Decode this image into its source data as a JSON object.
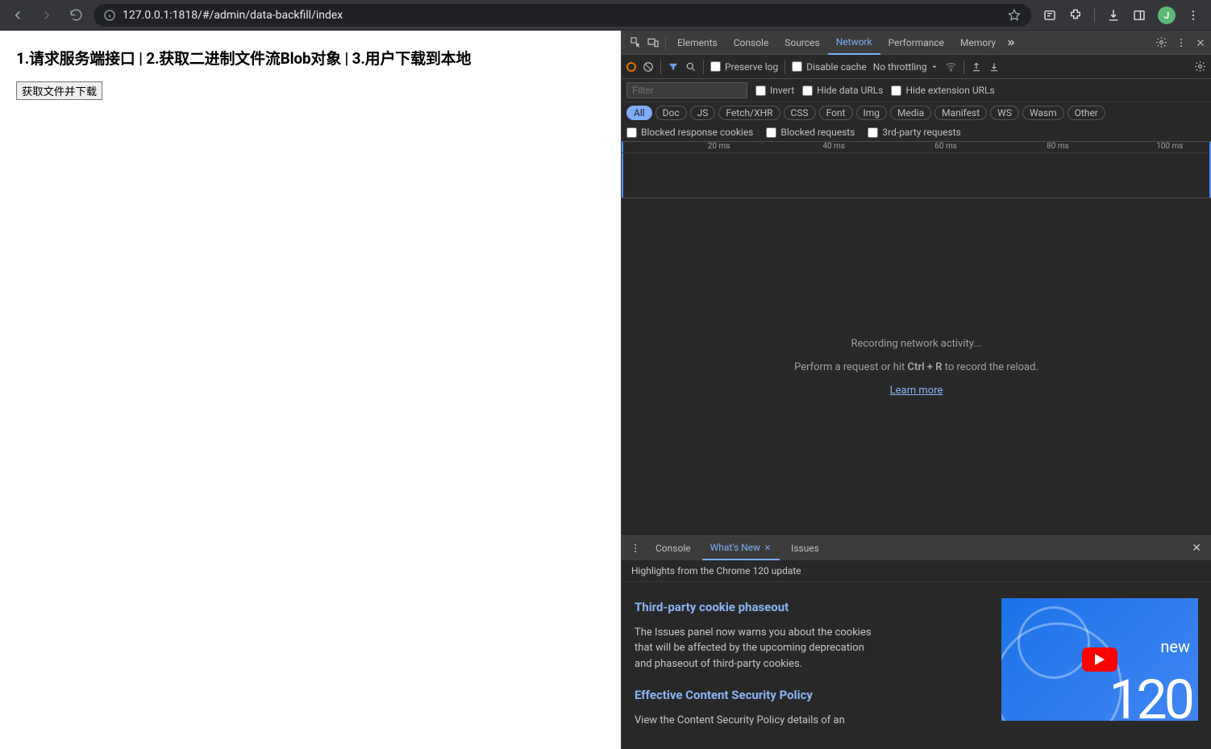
{
  "browser": {
    "url": "127.0.0.1:1818/#/admin/data-backfill/index",
    "avatar_letter": "J"
  },
  "page": {
    "heading": "1.请求服务端接口 | 2.获取二进制文件流Blob对象 | 3.用户下载到本地",
    "download_button": "获取文件并下载"
  },
  "devtools": {
    "tabs": [
      "Elements",
      "Console",
      "Sources",
      "Network",
      "Performance",
      "Memory"
    ],
    "active_tab": "Network",
    "preserve_log": "Preserve log",
    "disable_cache": "Disable cache",
    "throttling": "No throttling",
    "filter_placeholder": "Filter",
    "invert": "Invert",
    "hide_data_urls": "Hide data URLs",
    "hide_ext_urls": "Hide extension URLs",
    "type_chips": [
      "All",
      "Doc",
      "JS",
      "Fetch/XHR",
      "CSS",
      "Font",
      "Img",
      "Media",
      "Manifest",
      "WS",
      "Wasm",
      "Other"
    ],
    "blocked_cookies": "Blocked response cookies",
    "blocked_requests": "Blocked requests",
    "third_party": "3rd-party requests",
    "timeline_ticks": [
      "20 ms",
      "40 ms",
      "60 ms",
      "80 ms",
      "100 ms"
    ],
    "recording_msg": "Recording network activity...",
    "hint_prefix": "Perform a request or hit ",
    "hint_key": "Ctrl + R",
    "hint_suffix": " to record the reload.",
    "learn_more": "Learn more"
  },
  "drawer": {
    "tabs": [
      "Console",
      "What's New",
      "Issues"
    ],
    "active_tab": "What's New",
    "highlights": "Highlights from the Chrome 120 update",
    "article1_title": "Third-party cookie phaseout",
    "article1_body": "The Issues panel now warns you about the cookies that will be affected by the upcoming deprecation and phaseout of third-party cookies.",
    "article2_title": "Effective Content Security Policy",
    "article2_body": "View the Content Security Policy details of an",
    "thumb_new": "new",
    "thumb_num": "120"
  }
}
